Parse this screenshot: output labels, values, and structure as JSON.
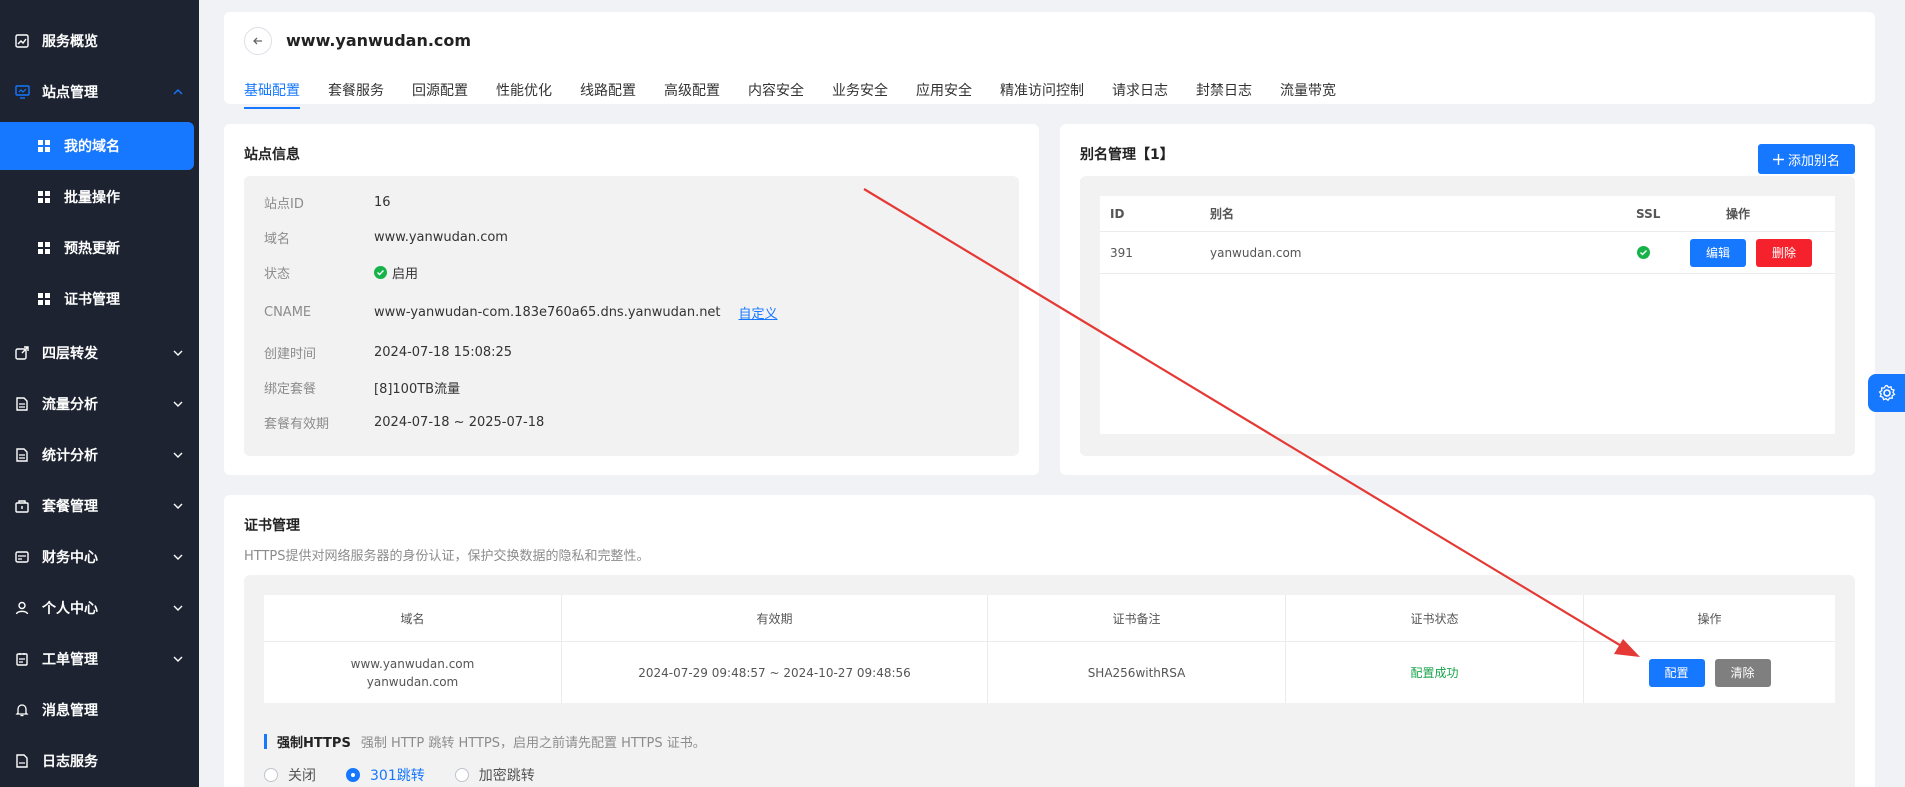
{
  "sidebar": {
    "items": [
      {
        "label": "服务概览",
        "icon": "dashboard-icon"
      },
      {
        "label": "站点管理",
        "icon": "monitor-icon"
      },
      {
        "label": "我的域名",
        "icon": "grid-icon"
      },
      {
        "label": "批量操作",
        "icon": "grid-icon"
      },
      {
        "label": "预热更新",
        "icon": "grid-icon"
      },
      {
        "label": "证书管理",
        "icon": "grid-icon"
      },
      {
        "label": "四层转发",
        "icon": "share-icon"
      },
      {
        "label": "流量分析",
        "icon": "document-icon"
      },
      {
        "label": "统计分析",
        "icon": "document-icon"
      },
      {
        "label": "套餐管理",
        "icon": "package-icon"
      },
      {
        "label": "财务中心",
        "icon": "wallet-icon"
      },
      {
        "label": "个人中心",
        "icon": "user-icon"
      },
      {
        "label": "工单管理",
        "icon": "ticket-icon"
      },
      {
        "label": "消息管理",
        "icon": "bell-icon"
      },
      {
        "label": "日志服务",
        "icon": "log-icon"
      }
    ]
  },
  "header": {
    "title": "www.yanwudan.com",
    "tabs": [
      "基础配置",
      "套餐服务",
      "回源配置",
      "性能优化",
      "线路配置",
      "高级配置",
      "内容安全",
      "业务安全",
      "应用安全",
      "精准访问控制",
      "请求日志",
      "封禁日志",
      "流量带宽"
    ]
  },
  "site_info": {
    "title": "站点信息",
    "rows": [
      {
        "key": "站点ID",
        "value": "16"
      },
      {
        "key": "域名",
        "value": "www.yanwudan.com"
      },
      {
        "key": "状态",
        "value": "启用"
      },
      {
        "key": "CNAME",
        "value": "www-yanwudan-com.183e760a65.dns.yanwudan.net"
      },
      {
        "key": "创建时间",
        "value": "2024-07-18 15:08:25"
      },
      {
        "key": "绑定套餐",
        "value": "[8]100TB流量"
      },
      {
        "key": "套餐有效期",
        "value": "2024-07-18 ~ 2025-07-18"
      }
    ],
    "cname_link": "自定义"
  },
  "alias": {
    "title": "别名管理【1】",
    "add_label": "添加别名",
    "headers": [
      "ID",
      "别名",
      "SSL",
      "操作"
    ],
    "rows": [
      {
        "id": "391",
        "alias": "yanwudan.com"
      }
    ],
    "edit_label": "编辑",
    "delete_label": "删除"
  },
  "cert": {
    "title": "证书管理",
    "subtitle": "HTTPS提供对网络服务器的身份认证，保护交换数据的隐私和完整性。",
    "headers": [
      "域名",
      "有效期",
      "证书备注",
      "证书状态",
      "操作"
    ],
    "row": {
      "domain1": "www.yanwudan.com",
      "domain2": "yanwudan.com",
      "validity": "2024-07-29 09:48:57 ~ 2024-10-27 09:48:56",
      "remark": "SHA256withRSA",
      "status": "配置成功"
    },
    "config_label": "配置",
    "clear_label": "清除",
    "force_title": "强制HTTPS",
    "force_desc": "强制 HTTP 跳转 HTTPS，启用之前请先配置 HTTPS 证书。",
    "radio_options": [
      "关闭",
      "301跳转",
      "加密跳转"
    ],
    "radio_selected": "301跳转"
  },
  "colors": {
    "accent": "#1677ff",
    "sidebar_bg": "#1d2330",
    "success": "#17a34a",
    "danger": "#f5222d",
    "annotation_arrow": "#e53935"
  }
}
